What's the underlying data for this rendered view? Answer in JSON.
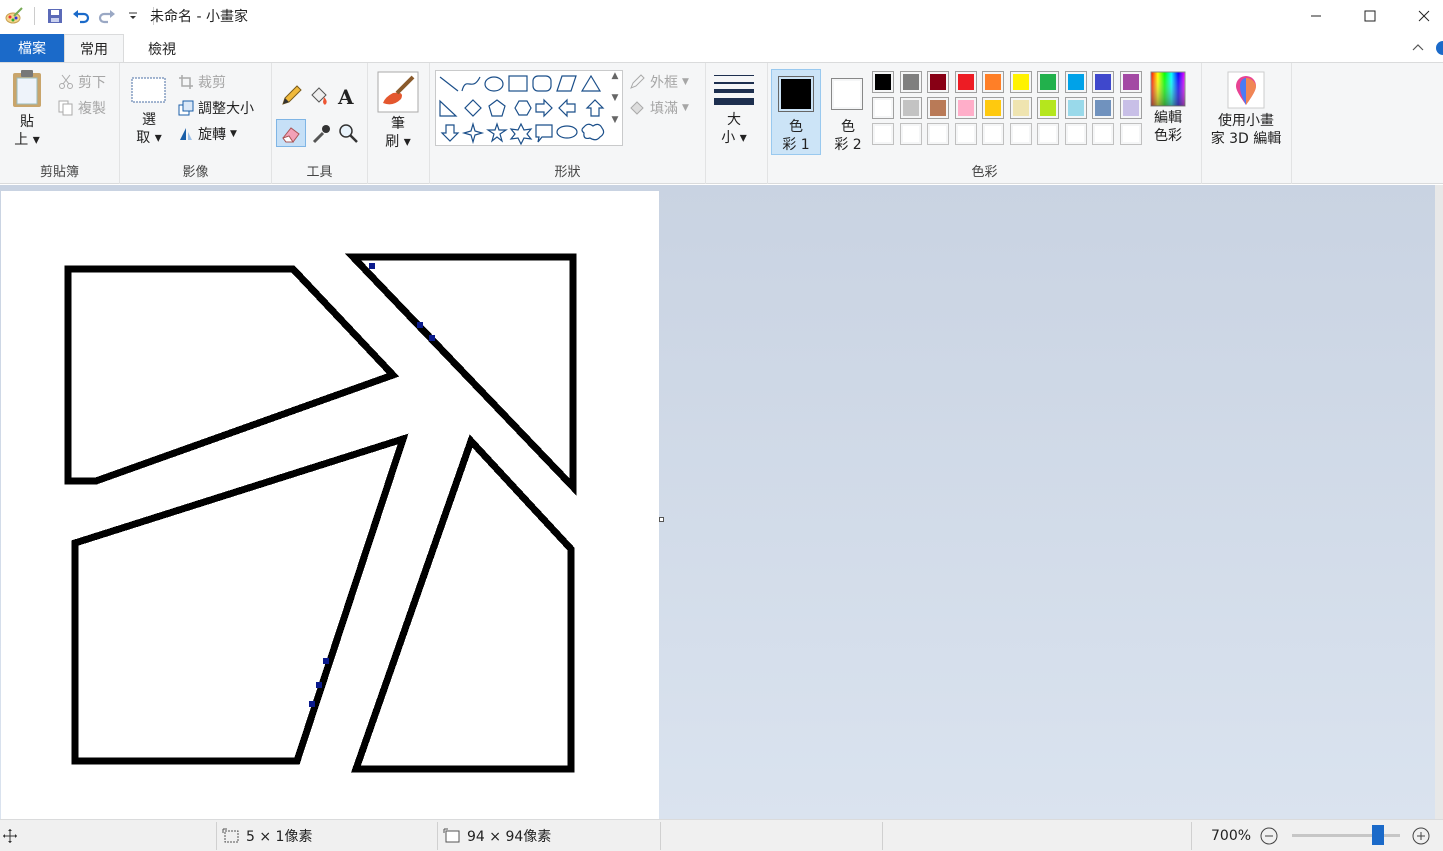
{
  "window": {
    "title": "未命名 - 小畫家",
    "minimize_glyph": "—",
    "maximize_glyph": "☐",
    "close_glyph": "✕"
  },
  "tabs": {
    "file": "檔案",
    "home": "常用",
    "view": "檢視"
  },
  "clipboard": {
    "paste_top": "貼",
    "paste_bottom": "上",
    "cut": "剪下",
    "copy": "複製",
    "group_label": "剪貼簿"
  },
  "image": {
    "select_top": "選",
    "select_bottom": "取",
    "crop": "裁剪",
    "resize": "調整大小",
    "rotate": "旋轉",
    "group_label": "影像"
  },
  "tools": {
    "group_label": "工具"
  },
  "brushes": {
    "top": "筆",
    "bottom": "刷"
  },
  "shapes": {
    "outline": "外框",
    "fill": "填滿",
    "group_label": "形狀"
  },
  "size": {
    "top": "大",
    "bottom": "小"
  },
  "colors": {
    "color1_top": "色",
    "color1_bottom": "彩 1",
    "color2_top": "色",
    "color2_bottom": "彩 2",
    "edit_top": "編輯",
    "edit_bottom": "色彩",
    "group_label": "色彩",
    "color1_value": "#000000",
    "color2_value": "#ffffff",
    "palette_row1": [
      "#000000",
      "#7f7f7f",
      "#880015",
      "#ed1c24",
      "#ff7f27",
      "#fff200",
      "#22b14c",
      "#00a2e8",
      "#3f48cc",
      "#a349a4"
    ],
    "palette_row2": [
      "#ffffff",
      "#c3c3c3",
      "#b97a57",
      "#ffaec9",
      "#ffc90e",
      "#efe4b0",
      "#b5e61d",
      "#99d9ea",
      "#7092be",
      "#c8bfe7"
    ],
    "palette_row3": [
      "#ffffff",
      "#ffffff",
      "#ffffff",
      "#ffffff",
      "#ffffff",
      "#ffffff",
      "#ffffff",
      "#ffffff",
      "#ffffff",
      "#ffffff"
    ]
  },
  "paint3d": {
    "top": "使用小畫",
    "bottom": "家 3D 編輯"
  },
  "status": {
    "selection_size": "5 × 1像素",
    "canvas_size": "94 × 94像素",
    "zoom": "700%",
    "zoom_percent": 70
  }
}
